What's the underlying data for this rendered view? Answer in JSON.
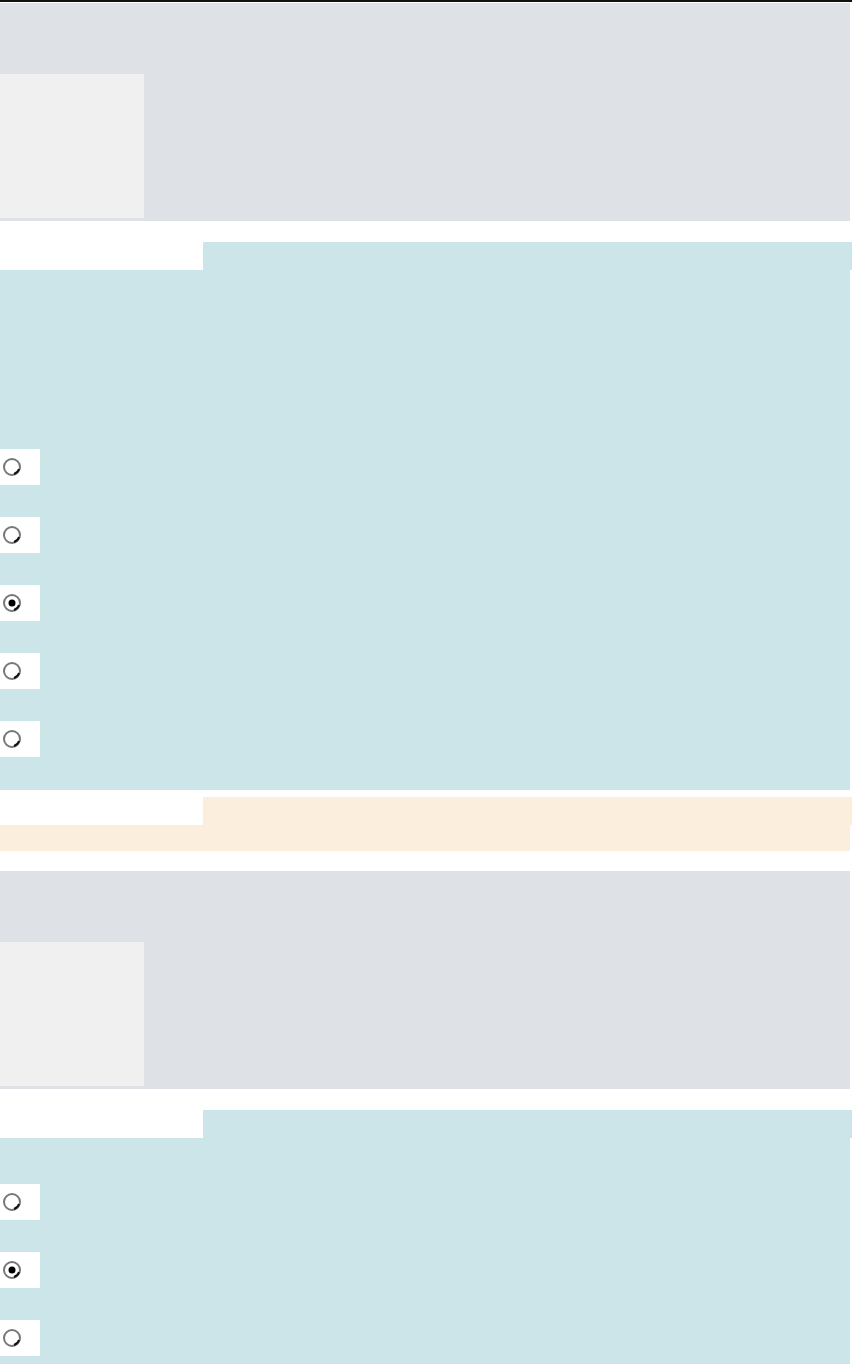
{
  "sections": [
    {
      "kind": "image"
    },
    {
      "kind": "choices",
      "options": [
        {
          "selected": false
        },
        {
          "selected": false
        },
        {
          "selected": true
        },
        {
          "selected": false
        },
        {
          "selected": false
        }
      ]
    },
    {
      "kind": "note"
    },
    {
      "kind": "image"
    },
    {
      "kind": "choices",
      "options": [
        {
          "selected": false
        },
        {
          "selected": true
        },
        {
          "selected": false
        }
      ]
    }
  ]
}
